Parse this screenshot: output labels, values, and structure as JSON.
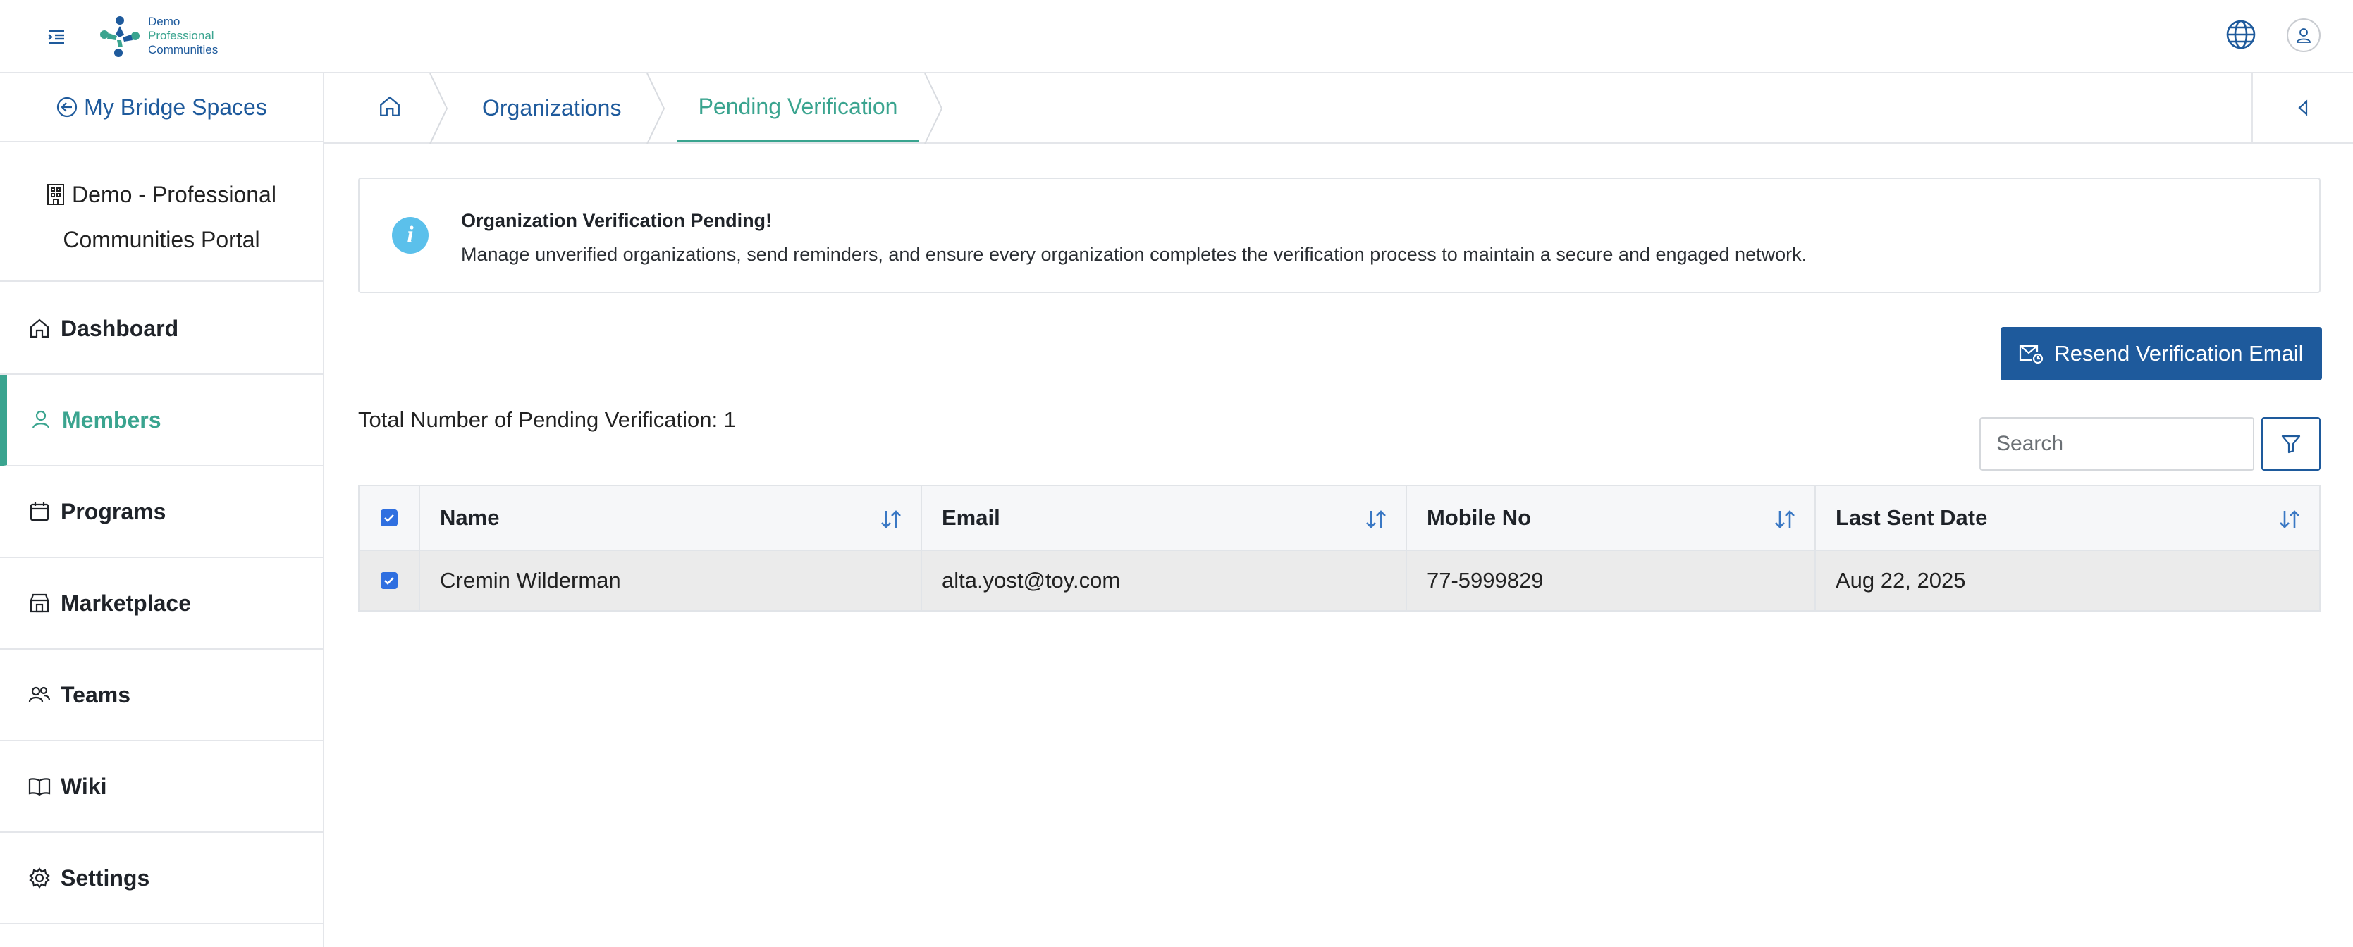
{
  "topbar": {
    "logo_line1": "Demo",
    "logo_line2": "Professional",
    "logo_line3": "Communities",
    "menu_icon": "menu-indent-icon",
    "globe_icon": "globe-icon",
    "avatar_icon": "user-icon"
  },
  "sidebar": {
    "back_label": "My Bridge Spaces",
    "portal_line1": "Demo - Professional",
    "portal_line2": "Communities Portal",
    "items": [
      {
        "label": "Dashboard",
        "icon": "home-icon"
      },
      {
        "label": "Members",
        "icon": "user-icon",
        "active": true
      },
      {
        "label": "Programs",
        "icon": "calendar-icon"
      },
      {
        "label": "Marketplace",
        "icon": "store-icon"
      },
      {
        "label": "Teams",
        "icon": "users-icon"
      },
      {
        "label": "Wiki",
        "icon": "book-icon"
      },
      {
        "label": "Settings",
        "icon": "gear-icon"
      }
    ]
  },
  "breadcrumb": {
    "items": [
      "Organizations",
      "Pending Verification"
    ]
  },
  "alert": {
    "title": "Organization Verification Pending!",
    "text": "Manage unverified organizations, send reminders, and ensure every organization completes the verification process to maintain a secure and engaged network."
  },
  "actions": {
    "resend_label": "Resend Verification Email"
  },
  "summary": {
    "total_label": "Total Number of Pending Verification: 1"
  },
  "search": {
    "placeholder": "Search"
  },
  "table": {
    "columns": [
      "Name",
      "Email",
      "Mobile No",
      "Last Sent Date"
    ],
    "rows": [
      {
        "name": "Cremin Wilderman",
        "email": "alta.yost@toy.com",
        "mobile": "77-5999829",
        "last_sent": "Aug 22, 2025"
      }
    ]
  },
  "colors": {
    "primary": "#1e5a9c",
    "accent": "#3aa48f",
    "info": "#5bc0eb"
  }
}
